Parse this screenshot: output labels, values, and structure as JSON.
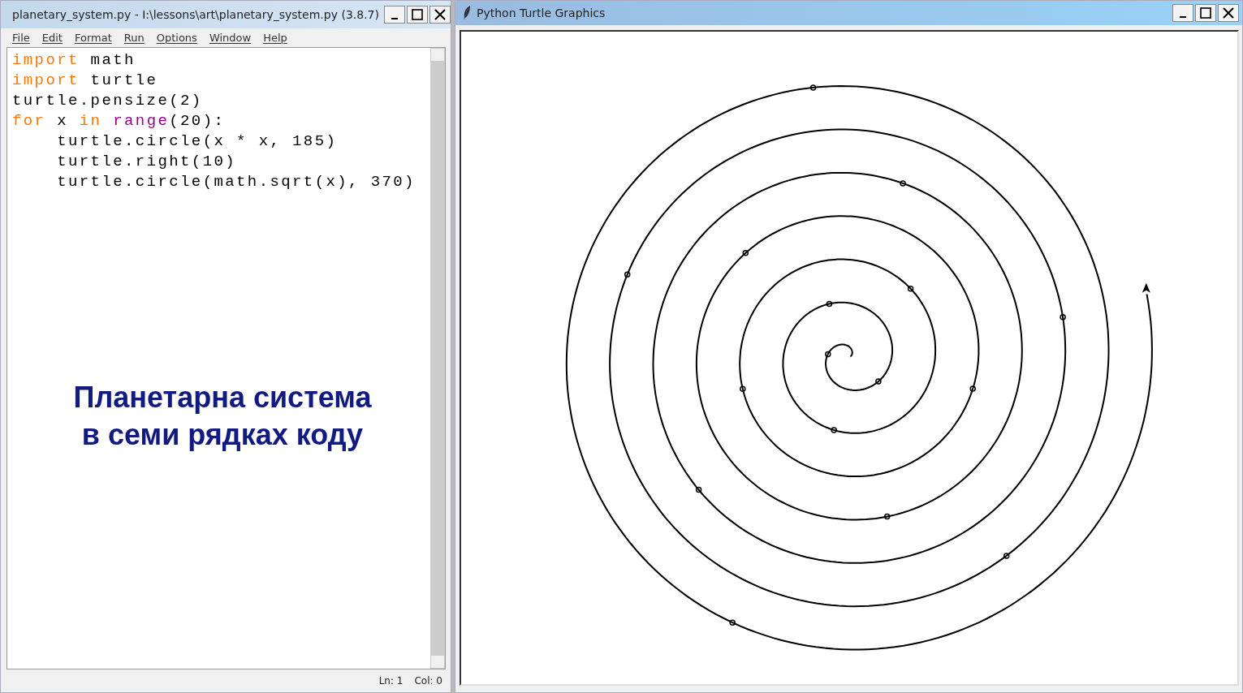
{
  "editor_window": {
    "title": "planetary_system.py - I:\\lessons\\art\\planetary_system.py (3.8.7)",
    "menu": [
      "File",
      "Edit",
      "Format",
      "Run",
      "Options",
      "Window",
      "Help"
    ],
    "code_lines": [
      [
        {
          "kind": "keyword",
          "text": "import"
        },
        {
          "kind": "plain",
          "text": " math"
        }
      ],
      [
        {
          "kind": "keyword",
          "text": "import"
        },
        {
          "kind": "plain",
          "text": " turtle"
        }
      ],
      [
        {
          "kind": "plain",
          "text": "turtle.pensize(2)"
        }
      ],
      [
        {
          "kind": "keyword",
          "text": "for"
        },
        {
          "kind": "plain",
          "text": " x "
        },
        {
          "kind": "keyword",
          "text": "in"
        },
        {
          "kind": "builtin",
          "text": " range"
        },
        {
          "kind": "plain",
          "text": "(20):"
        }
      ],
      [
        {
          "kind": "plain",
          "text": "    turtle.circle(x * x, 185)"
        }
      ],
      [
        {
          "kind": "plain",
          "text": "    turtle.right(10)"
        }
      ],
      [
        {
          "kind": "plain",
          "text": "    turtle.circle(math.sqrt(x), 370)"
        }
      ]
    ],
    "caption": [
      "Планетарна система",
      "в семи рядках коду"
    ],
    "status_bar": {
      "line": "Ln: 1",
      "column": "Col: 0"
    }
  },
  "turtle_window": {
    "title": "Python Turtle Graphics"
  }
}
